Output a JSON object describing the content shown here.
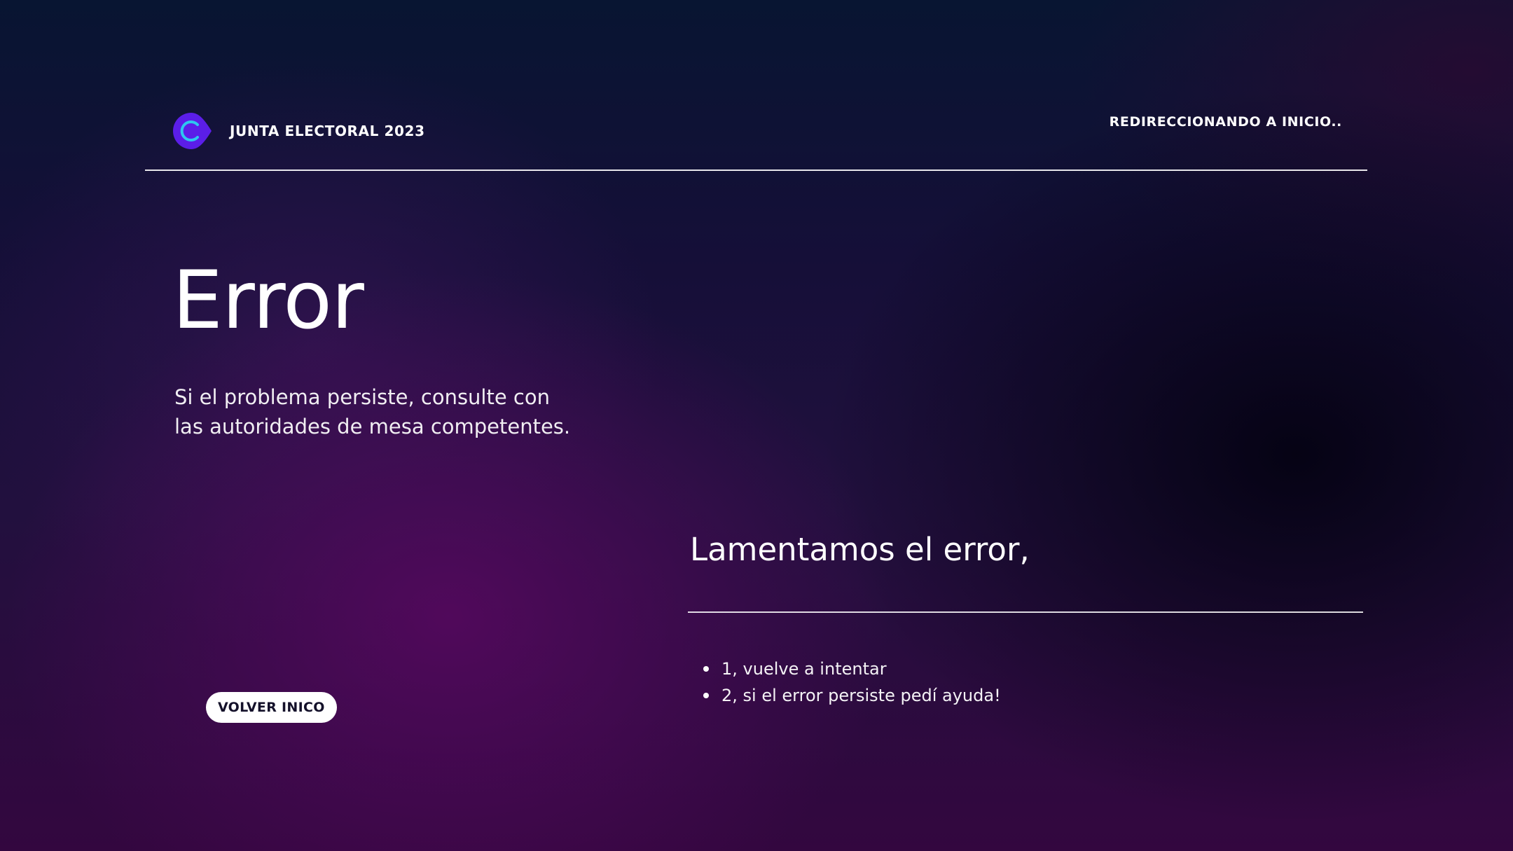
{
  "header": {
    "brand_name": "JUNTA ELECTORAL 2023",
    "logo_icon": "circle-c-logo-icon",
    "status_text": "REDIRECCIONANDO A INICIO.."
  },
  "main": {
    "title": "Error",
    "description_lines": [
      "Si el problema persiste, consulte con",
      "las autoridades de mesa competentes."
    ],
    "back_button_label": "VOLVER INICO"
  },
  "side": {
    "heading": "Lamentamos el error,",
    "steps": [
      "1, vuelve a intentar",
      "2, si el error persiste pedí ayuda!"
    ]
  },
  "colors": {
    "logo_fill": "#5b1ee8",
    "logo_accent": "#2ec6f0",
    "button_bg": "#ffffff",
    "button_text": "#14112a"
  }
}
